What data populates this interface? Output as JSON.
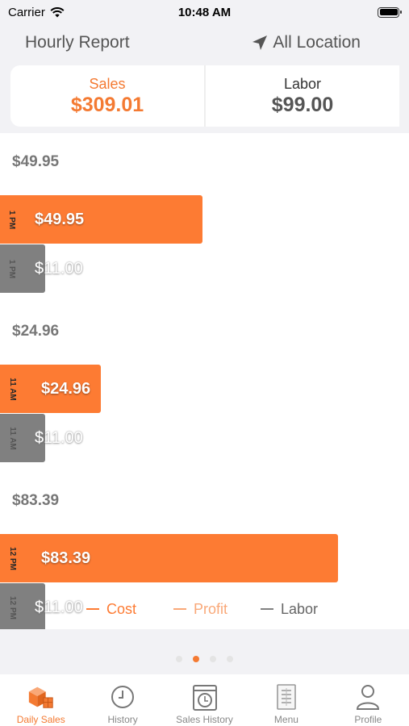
{
  "status_bar": {
    "carrier": "Carrier",
    "time": "10:48 AM"
  },
  "header": {
    "title": "Hourly Report",
    "location": "All Location"
  },
  "summary": {
    "sales_label": "Sales",
    "sales_value": "$309.01",
    "labor_label": "Labor",
    "labor_value": "$99.00"
  },
  "colors": {
    "accent": "#f47a32",
    "cost": "#fd7b33",
    "profit": "#f9a878",
    "labor": "#808080"
  },
  "chart_data": {
    "type": "bar",
    "orientation": "horizontal",
    "categories": [
      "1 PM",
      "11 AM",
      "12 PM"
    ],
    "series": [
      {
        "name": "Cost",
        "values": [
          49.95,
          24.96,
          83.39
        ],
        "labels": [
          "$49.95",
          "$24.96",
          "$83.39"
        ]
      },
      {
        "name": "Labor",
        "values": [
          11.0,
          11.0,
          11.0
        ],
        "labels": [
          "$11.00",
          "$11.00",
          "$11.00"
        ]
      }
    ],
    "group_totals": [
      "$49.95",
      "$24.96",
      "$83.39"
    ],
    "legend": [
      "Cost",
      "Profit",
      "Labor"
    ],
    "xlim": [
      0,
      100
    ]
  },
  "page_indicator": {
    "count": 4,
    "active": 1
  },
  "tabs": [
    {
      "label": "Daily Sales",
      "icon": "boxes-icon",
      "active": true
    },
    {
      "label": "History",
      "icon": "clock-icon",
      "active": false
    },
    {
      "label": "Sales History",
      "icon": "calendar-clock-icon",
      "active": false
    },
    {
      "label": "Menu",
      "icon": "menu-doc-icon",
      "active": false
    },
    {
      "label": "Profile",
      "icon": "person-icon",
      "active": false
    }
  ]
}
